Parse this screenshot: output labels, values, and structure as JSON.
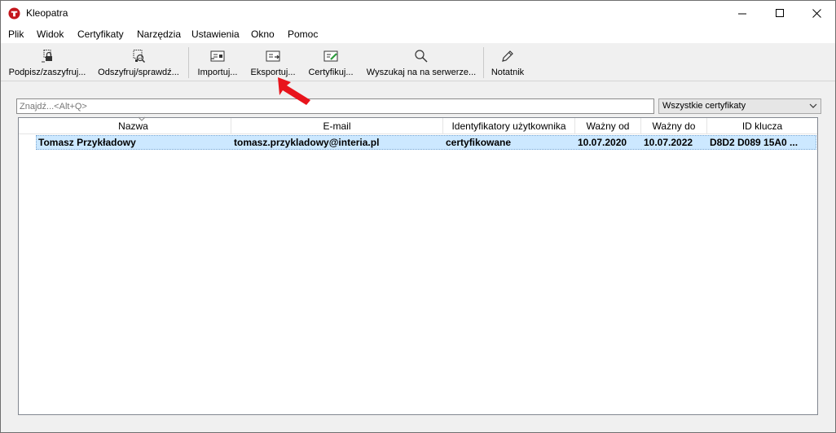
{
  "window": {
    "title": "Kleopatra",
    "controls": {
      "minimize": "minimize",
      "maximize": "maximize",
      "close": "close"
    }
  },
  "menubar": {
    "items": [
      "Plik",
      "Widok",
      "Certyfikaty",
      "Narzędzia",
      "Ustawienia",
      "Okno",
      "Pomoc"
    ]
  },
  "toolbar": {
    "buttons": [
      {
        "label": "Podpisz/zaszyfruj...",
        "icon": "sign-encrypt-icon"
      },
      {
        "label": "Odszyfruj/sprawdź...",
        "icon": "decrypt-verify-icon"
      },
      {
        "label": "Importuj...",
        "icon": "import-certificate-icon"
      },
      {
        "label": "Eksportuj...",
        "icon": "export-certificate-icon"
      },
      {
        "label": "Certyfikuj...",
        "icon": "certify-icon"
      },
      {
        "label": "Wyszukaj na na serwerze...",
        "icon": "search-server-icon"
      },
      {
        "label": "Notatnik",
        "icon": "notepad-pencil-icon"
      }
    ]
  },
  "search": {
    "placeholder": "Znajdź...<Alt+Q>",
    "value": ""
  },
  "filter": {
    "selected": "Wszystkie certyfikaty"
  },
  "table": {
    "columns": [
      "Nazwa",
      "E-mail",
      "Identyfikatory użytkownika",
      "Ważny od",
      "Ważny do",
      "ID klucza"
    ],
    "rows": [
      {
        "name": "Tomasz Przykładowy",
        "email": "tomasz.przykladowy@interia.pl",
        "user_ids": "certyfikowane",
        "valid_from": "10.07.2020",
        "valid_to": "10.07.2022",
        "key_id": "D8D2 D089 15A0 ..."
      }
    ]
  },
  "colors": {
    "selection": "#cce8ff",
    "annotation_arrow": "#e8141c",
    "app_icon": "#c4161c"
  }
}
